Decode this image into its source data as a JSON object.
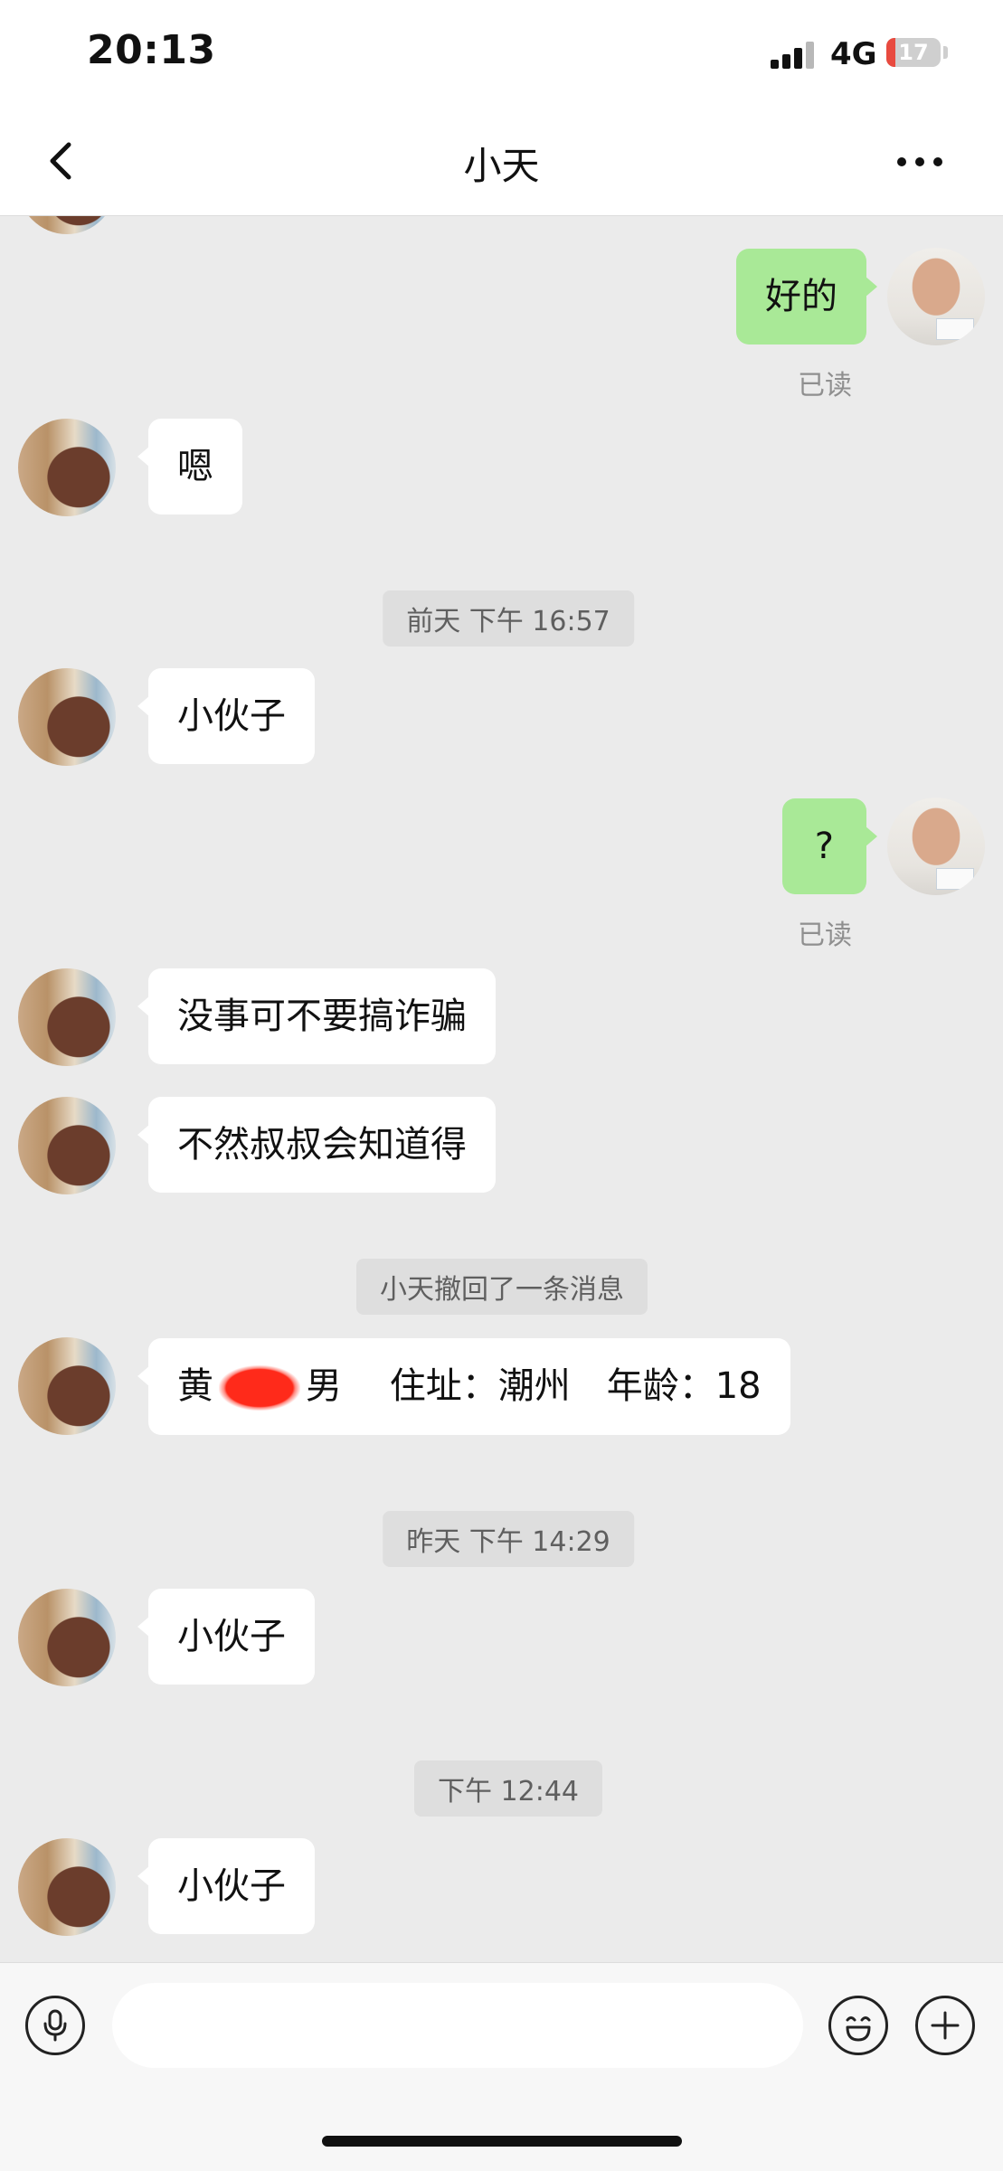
{
  "status_bar": {
    "time": "20:13",
    "network": "4G",
    "battery": "17",
    "battery_level": 0.17,
    "battery_color": "#e84a3f"
  },
  "nav": {
    "back_icon": "chevron-left-icon",
    "title": "小天",
    "more_icon": "more-dots-icon"
  },
  "messages": [
    {
      "from": "me",
      "text": "好的",
      "status": "已读"
    },
    {
      "from": "them",
      "text": "嗯"
    },
    {
      "timestamp": "前天 下午 16:57"
    },
    {
      "from": "them",
      "text": "小伙子"
    },
    {
      "from": "me",
      "text": "?",
      "status": "已读"
    },
    {
      "from": "them",
      "text": "没事可不要搞诈骗"
    },
    {
      "from": "them",
      "text": "不然叔叔会知道得"
    },
    {
      "notice": "小天撤回了一条消息"
    },
    {
      "from": "them",
      "text_parts": [
        "黄",
        "男　 住址：潮州　年龄：18"
      ],
      "redacted": true
    },
    {
      "timestamp": "昨天 下午 14:29"
    },
    {
      "from": "them",
      "text": "小伙子"
    },
    {
      "timestamp": "下午 12:44"
    },
    {
      "from": "them",
      "text": "小伙子"
    }
  ],
  "input_bar": {
    "voice_icon": "microphone-icon",
    "input_value": "",
    "input_placeholder": "",
    "emoji_icon": "emoji-icon",
    "add_icon": "plus-icon"
  },
  "colors": {
    "background": "#ebebeb",
    "outgoing_bubble": "#a9e997",
    "incoming_bubble": "#ffffff"
  }
}
